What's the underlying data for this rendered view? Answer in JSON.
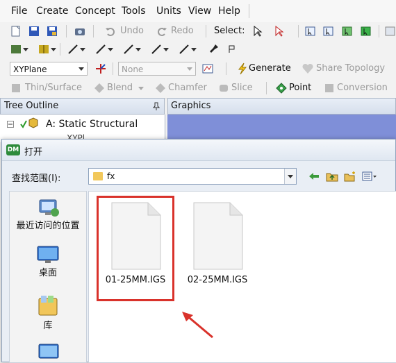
{
  "menu": [
    "File",
    "Create",
    "Concept",
    "Tools",
    "Units",
    "View",
    "Help"
  ],
  "toolbar1": {
    "undo": "Undo",
    "redo": "Redo",
    "select": "Select:"
  },
  "toolbar3": {
    "plane": "XYPlane",
    "sketch": "None",
    "generate": "Generate",
    "share_topology": "Share Topology"
  },
  "toolbar4": {
    "thin_surface": "Thin/Surface",
    "blend": "Blend",
    "chamfer": "Chamfer",
    "slice": "Slice",
    "point": "Point",
    "conversion": "Conversion"
  },
  "panels": {
    "tree_title": "Tree Outline",
    "tree_root": "A: Static Structural",
    "tree_child": "XYPl",
    "graphics_title": "Graphics"
  },
  "dialog": {
    "icon_text": "DM",
    "title": "打开",
    "look_in_label": "查找范围(I):",
    "look_in_value": "fx",
    "places": [
      "最近访问的位置",
      "桌面",
      "库"
    ],
    "files": [
      "01-25MM.IGS",
      "02-25MM.IGS"
    ]
  },
  "colors": {
    "highlight": "#d9322b",
    "graphics_bg": "#7f8fd8"
  }
}
